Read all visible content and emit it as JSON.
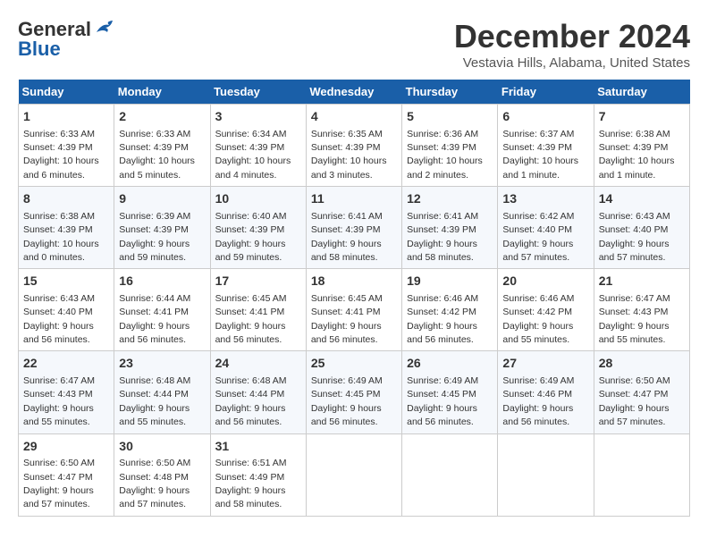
{
  "header": {
    "logo_line1": "General",
    "logo_line2": "Blue",
    "month_title": "December 2024",
    "location": "Vestavia Hills, Alabama, United States"
  },
  "weekdays": [
    "Sunday",
    "Monday",
    "Tuesday",
    "Wednesday",
    "Thursday",
    "Friday",
    "Saturday"
  ],
  "weeks": [
    [
      {
        "day": "1",
        "sunrise": "6:33 AM",
        "sunset": "4:39 PM",
        "daylight": "10 hours and 6 minutes."
      },
      {
        "day": "2",
        "sunrise": "6:33 AM",
        "sunset": "4:39 PM",
        "daylight": "10 hours and 5 minutes."
      },
      {
        "day": "3",
        "sunrise": "6:34 AM",
        "sunset": "4:39 PM",
        "daylight": "10 hours and 4 minutes."
      },
      {
        "day": "4",
        "sunrise": "6:35 AM",
        "sunset": "4:39 PM",
        "daylight": "10 hours and 3 minutes."
      },
      {
        "day": "5",
        "sunrise": "6:36 AM",
        "sunset": "4:39 PM",
        "daylight": "10 hours and 2 minutes."
      },
      {
        "day": "6",
        "sunrise": "6:37 AM",
        "sunset": "4:39 PM",
        "daylight": "10 hours and 1 minute."
      },
      {
        "day": "7",
        "sunrise": "6:38 AM",
        "sunset": "4:39 PM",
        "daylight": "10 hours and 1 minute."
      }
    ],
    [
      {
        "day": "8",
        "sunrise": "6:38 AM",
        "sunset": "4:39 PM",
        "daylight": "10 hours and 0 minutes."
      },
      {
        "day": "9",
        "sunrise": "6:39 AM",
        "sunset": "4:39 PM",
        "daylight": "9 hours and 59 minutes."
      },
      {
        "day": "10",
        "sunrise": "6:40 AM",
        "sunset": "4:39 PM",
        "daylight": "9 hours and 59 minutes."
      },
      {
        "day": "11",
        "sunrise": "6:41 AM",
        "sunset": "4:39 PM",
        "daylight": "9 hours and 58 minutes."
      },
      {
        "day": "12",
        "sunrise": "6:41 AM",
        "sunset": "4:39 PM",
        "daylight": "9 hours and 58 minutes."
      },
      {
        "day": "13",
        "sunrise": "6:42 AM",
        "sunset": "4:40 PM",
        "daylight": "9 hours and 57 minutes."
      },
      {
        "day": "14",
        "sunrise": "6:43 AM",
        "sunset": "4:40 PM",
        "daylight": "9 hours and 57 minutes."
      }
    ],
    [
      {
        "day": "15",
        "sunrise": "6:43 AM",
        "sunset": "4:40 PM",
        "daylight": "9 hours and 56 minutes."
      },
      {
        "day": "16",
        "sunrise": "6:44 AM",
        "sunset": "4:41 PM",
        "daylight": "9 hours and 56 minutes."
      },
      {
        "day": "17",
        "sunrise": "6:45 AM",
        "sunset": "4:41 PM",
        "daylight": "9 hours and 56 minutes."
      },
      {
        "day": "18",
        "sunrise": "6:45 AM",
        "sunset": "4:41 PM",
        "daylight": "9 hours and 56 minutes."
      },
      {
        "day": "19",
        "sunrise": "6:46 AM",
        "sunset": "4:42 PM",
        "daylight": "9 hours and 56 minutes."
      },
      {
        "day": "20",
        "sunrise": "6:46 AM",
        "sunset": "4:42 PM",
        "daylight": "9 hours and 55 minutes."
      },
      {
        "day": "21",
        "sunrise": "6:47 AM",
        "sunset": "4:43 PM",
        "daylight": "9 hours and 55 minutes."
      }
    ],
    [
      {
        "day": "22",
        "sunrise": "6:47 AM",
        "sunset": "4:43 PM",
        "daylight": "9 hours and 55 minutes."
      },
      {
        "day": "23",
        "sunrise": "6:48 AM",
        "sunset": "4:44 PM",
        "daylight": "9 hours and 55 minutes."
      },
      {
        "day": "24",
        "sunrise": "6:48 AM",
        "sunset": "4:44 PM",
        "daylight": "9 hours and 56 minutes."
      },
      {
        "day": "25",
        "sunrise": "6:49 AM",
        "sunset": "4:45 PM",
        "daylight": "9 hours and 56 minutes."
      },
      {
        "day": "26",
        "sunrise": "6:49 AM",
        "sunset": "4:45 PM",
        "daylight": "9 hours and 56 minutes."
      },
      {
        "day": "27",
        "sunrise": "6:49 AM",
        "sunset": "4:46 PM",
        "daylight": "9 hours and 56 minutes."
      },
      {
        "day": "28",
        "sunrise": "6:50 AM",
        "sunset": "4:47 PM",
        "daylight": "9 hours and 57 minutes."
      }
    ],
    [
      {
        "day": "29",
        "sunrise": "6:50 AM",
        "sunset": "4:47 PM",
        "daylight": "9 hours and 57 minutes."
      },
      {
        "day": "30",
        "sunrise": "6:50 AM",
        "sunset": "4:48 PM",
        "daylight": "9 hours and 57 minutes."
      },
      {
        "day": "31",
        "sunrise": "6:51 AM",
        "sunset": "4:49 PM",
        "daylight": "9 hours and 58 minutes."
      },
      null,
      null,
      null,
      null
    ]
  ]
}
